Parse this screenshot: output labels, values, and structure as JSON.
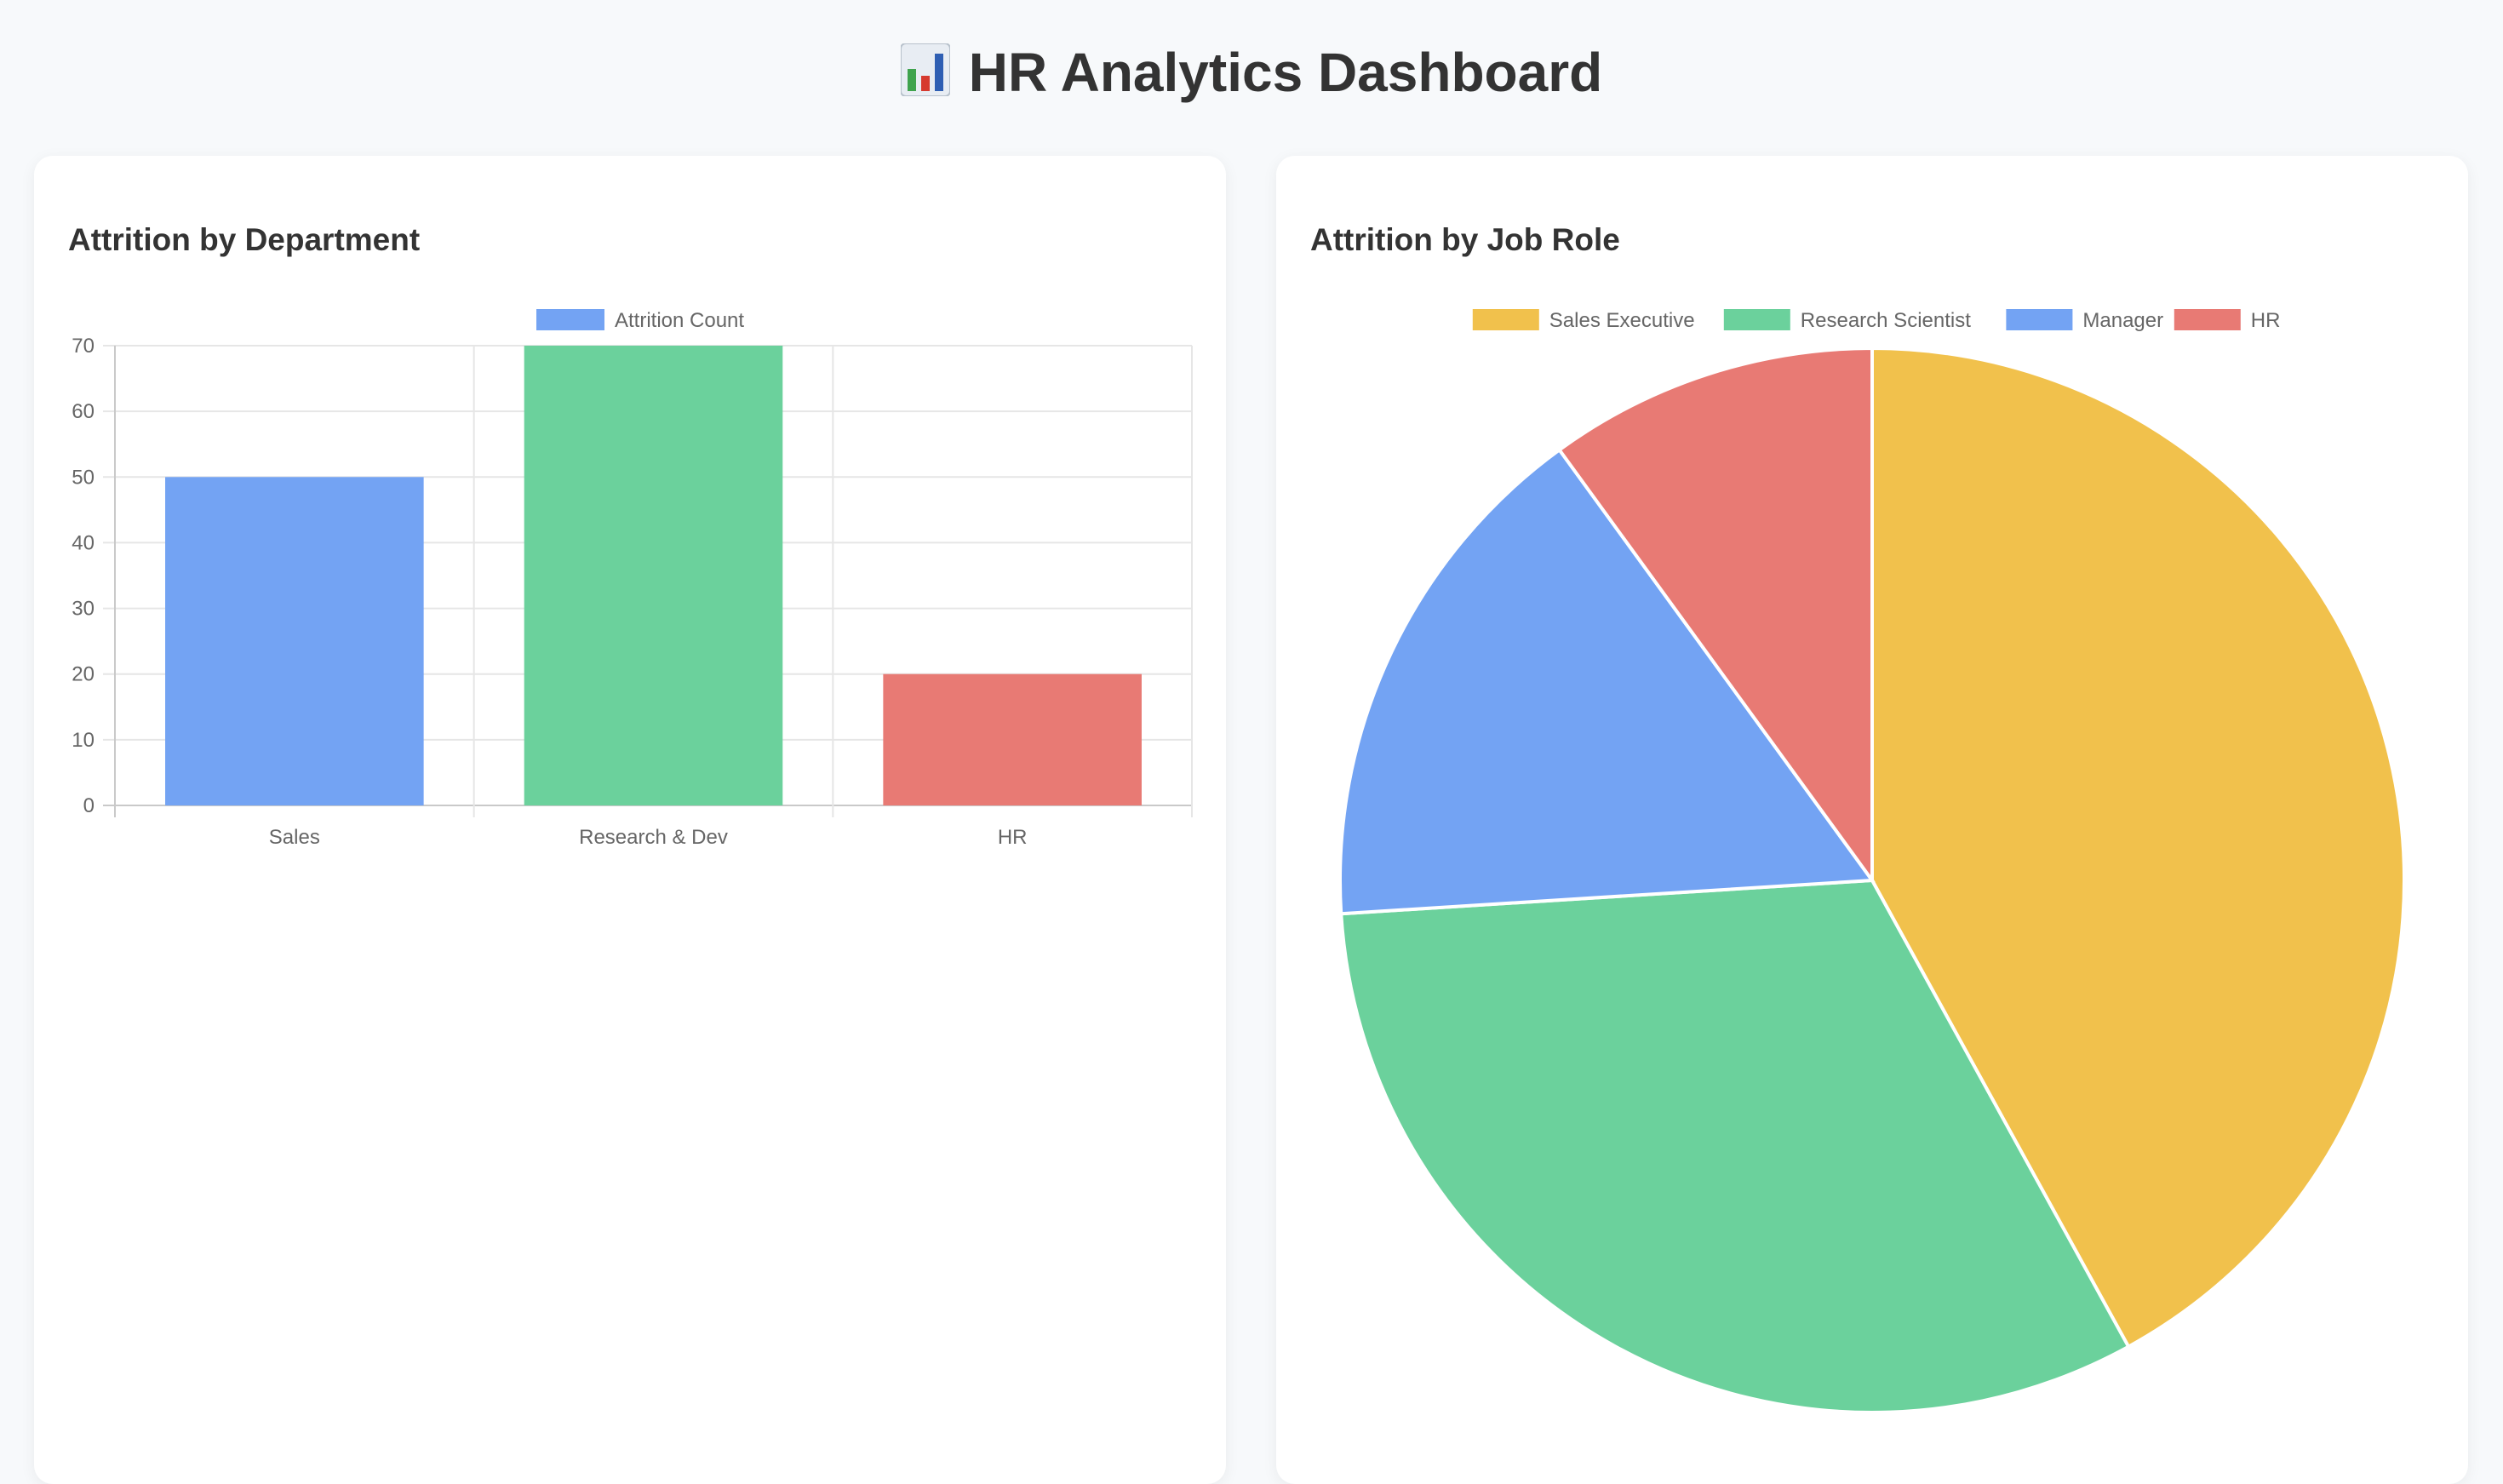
{
  "header": {
    "title": "HR Analytics Dashboard",
    "icon": "bar-chart-emoji-icon"
  },
  "cards": {
    "department": {
      "title": "Attrition by Department"
    },
    "job_role": {
      "title": "Attrition by Job Role"
    }
  },
  "chart_data": [
    {
      "type": "bar",
      "title": "Attrition by Department",
      "categories": [
        "Sales",
        "Research & Dev",
        "HR"
      ],
      "series": [
        {
          "name": "Attrition Count",
          "values": [
            50,
            70,
            20
          ]
        }
      ],
      "bar_colors": [
        "#73a3f3",
        "#6bd19c",
        "#e87a74"
      ],
      "legend_color": "#73a3f3",
      "ylim": [
        0,
        70
      ],
      "yticks": [
        0,
        10,
        20,
        30,
        40,
        50,
        60,
        70
      ],
      "grid": true,
      "legend_position": "top"
    },
    {
      "type": "pie",
      "title": "Attrition by Job Role",
      "labels": [
        "Sales Executive",
        "Research Scientist",
        "Manager",
        "HR"
      ],
      "values": [
        42,
        32,
        16,
        10
      ],
      "colors": [
        "#f1c14c",
        "#6bd19c",
        "#73a3f3",
        "#e87a74"
      ],
      "legend_position": "top"
    }
  ]
}
